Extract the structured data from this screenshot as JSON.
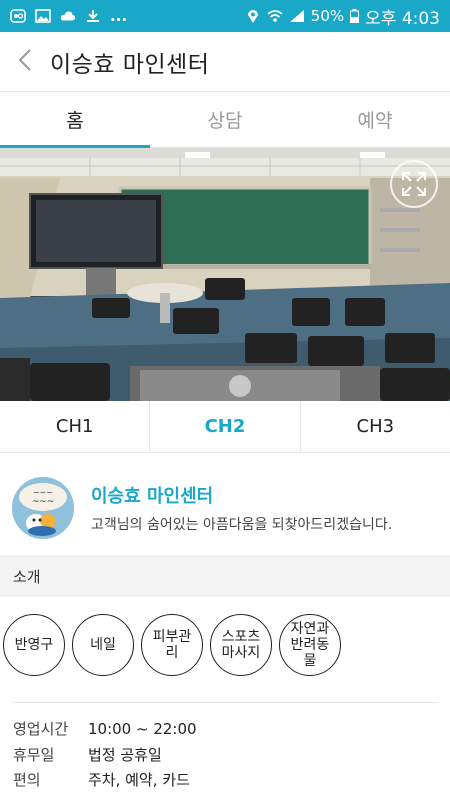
{
  "status_bar": {
    "left_icons": [
      "connection-icon",
      "image-icon",
      "cloud-icon",
      "download-icon"
    ],
    "overflow": "...",
    "battery_percent": "50%",
    "time": "오후 4:03"
  },
  "header": {
    "back_icon": "chevron-left-icon",
    "title": "이승효 마인센터"
  },
  "tabs": [
    {
      "label": "홈",
      "active": true
    },
    {
      "label": "상담",
      "active": false
    },
    {
      "label": "예약",
      "active": false
    }
  ],
  "camera": {
    "fullscreen_icon": "expand-icon"
  },
  "channels": [
    {
      "label": "CH1",
      "active": false
    },
    {
      "label": "CH2",
      "active": true
    },
    {
      "label": "CH3",
      "active": false
    }
  ],
  "profile": {
    "name": "이승효 마인센터",
    "description": "고객님의 숨어있는 아픔다움을 되찾아드리겠습니다."
  },
  "section": {
    "title": "소개"
  },
  "tags": [
    {
      "label": "반영구"
    },
    {
      "label": "네일"
    },
    {
      "label": "피부관\n리"
    },
    {
      "label": "스포츠\n마사지"
    },
    {
      "label": "자연과\n반려동\n물"
    }
  ],
  "info": [
    {
      "key": "영업시간",
      "value": "10:00 ~ 22:00"
    },
    {
      "key": "휴무일",
      "value": "법정 공휴일"
    },
    {
      "key": "편의",
      "value": "주차, 예약, 카드"
    }
  ],
  "colors": {
    "accent": "#1aa8c8",
    "text": "#222222",
    "section_bg": "#f3f3f3"
  }
}
